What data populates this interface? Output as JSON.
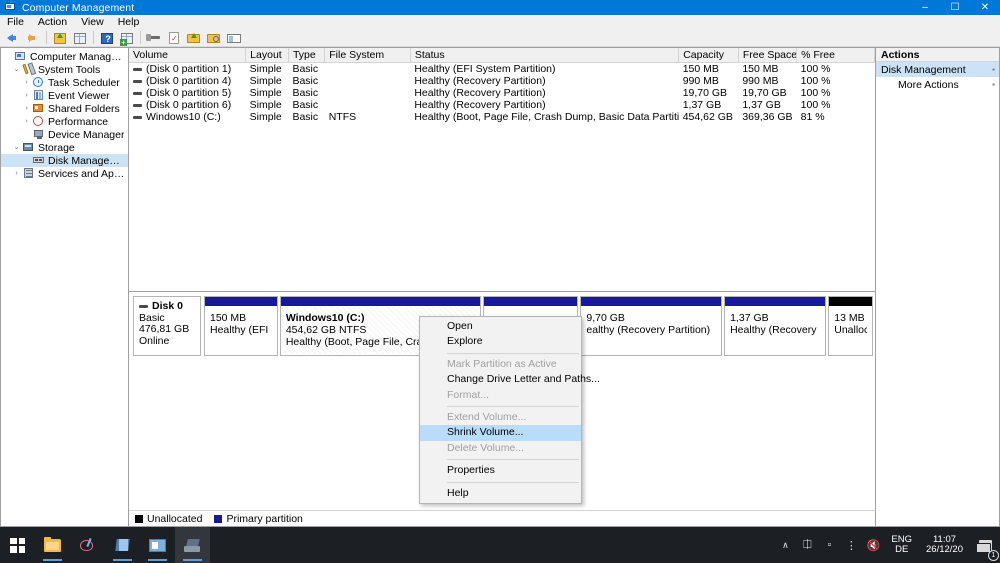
{
  "window": {
    "title": "Computer Management",
    "icon": "computer-management-icon",
    "controls": {
      "minimize": "–",
      "maximize": "☐",
      "close": "✕"
    }
  },
  "menubar": {
    "items": [
      "File",
      "Action",
      "View",
      "Help"
    ]
  },
  "toolbar": {
    "buttons": [
      "back-icon",
      "forward-icon",
      "up-folder-icon",
      "show-hide-console-tree-icon",
      "help-icon",
      "properties-icon",
      "wand-icon",
      "refresh-icon",
      "export-list-icon",
      "search-icon",
      "view-icon"
    ]
  },
  "tree": {
    "items": [
      {
        "label": "Computer Management (Local)",
        "icon": "computer-icon",
        "twisty": "",
        "indent": 0,
        "selected": false
      },
      {
        "label": "System Tools",
        "icon": "system-tools-icon",
        "twisty": "⌄",
        "indent": 1,
        "selected": false
      },
      {
        "label": "Task Scheduler",
        "icon": "task-scheduler-icon",
        "twisty": "›",
        "indent": 2,
        "selected": false
      },
      {
        "label": "Event Viewer",
        "icon": "event-viewer-icon",
        "twisty": "›",
        "indent": 2,
        "selected": false
      },
      {
        "label": "Shared Folders",
        "icon": "shared-folders-icon",
        "twisty": "›",
        "indent": 2,
        "selected": false
      },
      {
        "label": "Performance",
        "icon": "performance-icon",
        "twisty": "›",
        "indent": 2,
        "selected": false
      },
      {
        "label": "Device Manager",
        "icon": "device-manager-icon",
        "twisty": "",
        "indent": 2,
        "selected": false
      },
      {
        "label": "Storage",
        "icon": "storage-icon",
        "twisty": "⌄",
        "indent": 1,
        "selected": false
      },
      {
        "label": "Disk Management",
        "icon": "disk-management-icon",
        "twisty": "",
        "indent": 2,
        "selected": true
      },
      {
        "label": "Services and Applications",
        "icon": "services-icon",
        "twisty": "›",
        "indent": 1,
        "selected": false
      }
    ]
  },
  "volume_list": {
    "columns": [
      "Volume",
      "Layout",
      "Type",
      "File System",
      "Status",
      "Capacity",
      "Free Space",
      "% Free"
    ],
    "rows": [
      {
        "volume": "(Disk 0 partition 1)",
        "layout": "Simple",
        "type": "Basic",
        "fs": "",
        "status": "Healthy (EFI System Partition)",
        "capacity": "150 MB",
        "free_space": "150 MB",
        "pct_free": "100 %"
      },
      {
        "volume": "(Disk 0 partition 4)",
        "layout": "Simple",
        "type": "Basic",
        "fs": "",
        "status": "Healthy (Recovery Partition)",
        "capacity": "990 MB",
        "free_space": "990 MB",
        "pct_free": "100 %"
      },
      {
        "volume": "(Disk 0 partition 5)",
        "layout": "Simple",
        "type": "Basic",
        "fs": "",
        "status": "Healthy (Recovery Partition)",
        "capacity": "19,70 GB",
        "free_space": "19,70 GB",
        "pct_free": "100 %"
      },
      {
        "volume": "(Disk 0 partition 6)",
        "layout": "Simple",
        "type": "Basic",
        "fs": "",
        "status": "Healthy (Recovery Partition)",
        "capacity": "1,37 GB",
        "free_space": "1,37 GB",
        "pct_free": "100 %"
      },
      {
        "volume": "Windows10 (C:)",
        "layout": "Simple",
        "type": "Basic",
        "fs": "NTFS",
        "status": "Healthy (Boot, Page File, Crash Dump, Basic Data Partition)",
        "capacity": "454,62 GB",
        "free_space": "369,36 GB",
        "pct_free": "81 %"
      }
    ]
  },
  "graphical_view": {
    "disk": {
      "name": "Disk 0",
      "type": "Basic",
      "size": "476,81 GB",
      "status": "Online"
    },
    "partitions": [
      {
        "title": "",
        "size": "150 MB",
        "status": "Healthy (EFI Syster",
        "kind": "primary",
        "hatch": false,
        "width_pct": 11.2
      },
      {
        "title": "Windows10  (C:)",
        "size": "454,62 GB NTFS",
        "status": "Healthy (Boot, Page File, Crash Dump, Ba",
        "kind": "primary",
        "hatch": true,
        "width_pct": 30.5
      },
      {
        "title": "",
        "size": "",
        "status": "",
        "kind": "primary",
        "hatch": false,
        "width_pct": 14.5
      },
      {
        "title": "",
        "size": "9,70 GB",
        "status": "ealthy (Recovery Partition)",
        "kind": "primary",
        "hatch": false,
        "width_pct": 21.5
      },
      {
        "title": "",
        "size": "1,37 GB",
        "status": "Healthy (Recovery Partition)",
        "kind": "primary",
        "hatch": false,
        "width_pct": 15.5
      },
      {
        "title": "",
        "size": "13 MB",
        "status": "Unallocat",
        "kind": "unallocated",
        "hatch": false,
        "width_pct": 6.8
      }
    ],
    "legend": [
      {
        "label": "Unallocated",
        "color": "#000000"
      },
      {
        "label": "Primary partition",
        "color": "#18189c"
      }
    ]
  },
  "context_menu": {
    "items": [
      {
        "label": "Open",
        "disabled": false,
        "highlighted": false,
        "separator_after": false
      },
      {
        "label": "Explore",
        "disabled": false,
        "highlighted": false,
        "separator_after": true
      },
      {
        "label": "Mark Partition as Active",
        "disabled": true,
        "highlighted": false,
        "separator_after": false
      },
      {
        "label": "Change Drive Letter and Paths...",
        "disabled": false,
        "highlighted": false,
        "separator_after": false
      },
      {
        "label": "Format...",
        "disabled": true,
        "highlighted": false,
        "separator_after": true
      },
      {
        "label": "Extend Volume...",
        "disabled": true,
        "highlighted": false,
        "separator_after": false
      },
      {
        "label": "Shrink Volume...",
        "disabled": false,
        "highlighted": true,
        "separator_after": false
      },
      {
        "label": "Delete Volume...",
        "disabled": true,
        "highlighted": false,
        "separator_after": true
      },
      {
        "label": "Properties",
        "disabled": false,
        "highlighted": false,
        "separator_after": true
      },
      {
        "label": "Help",
        "disabled": false,
        "highlighted": false,
        "separator_after": false
      }
    ]
  },
  "actions_pane": {
    "header": "Actions",
    "rows": [
      {
        "label": "Disk Management",
        "mark": "▪",
        "selected": true,
        "sub": false
      },
      {
        "label": "More Actions",
        "mark": "▪",
        "selected": false,
        "sub": true
      }
    ]
  },
  "taskbar": {
    "apps": [
      {
        "name": "start-button",
        "icon": "windows-logo-icon",
        "active": false,
        "running": false
      },
      {
        "name": "file-explorer",
        "icon": "file-explorer-icon",
        "active": false,
        "running": true
      },
      {
        "name": "paint-app",
        "icon": "paint-icon",
        "active": false,
        "running": false
      },
      {
        "name": "notes-app",
        "icon": "notes-icon",
        "active": false,
        "running": true
      },
      {
        "name": "media-app",
        "icon": "media-icon",
        "active": false,
        "running": true
      },
      {
        "name": "computer-management-app",
        "icon": "computer-management-icon",
        "active": true,
        "running": true
      }
    ],
    "tray": {
      "chevron": "∧",
      "icons": [
        "onedrive-icon",
        "battery-icon",
        "network-icon",
        "volume-mute-icon"
      ],
      "language_top": "ENG",
      "language_bottom": "DE",
      "time": "11:07",
      "date": "26/12/20",
      "notification_count": "1"
    }
  }
}
